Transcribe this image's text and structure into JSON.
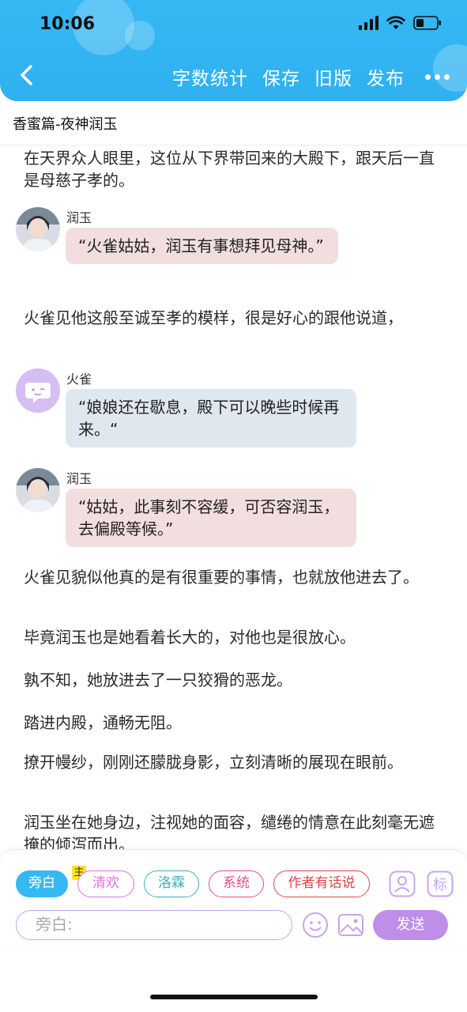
{
  "status_bar": {
    "time": "10:06"
  },
  "header": {
    "actions": [
      "字数统计",
      "保存",
      "旧版",
      "发布"
    ]
  },
  "title": "香蜜篇-夜神润玉",
  "content": {
    "para_1": "在天界众人眼里，这位从下界带回来的大殿下，跟天后一直是母慈子孝的。",
    "chat_1": {
      "speaker": "润玉",
      "text": "“火雀姑姑，润玉有事想拜见母神。”"
    },
    "para_2": "火雀见他这般至诚至孝的模样，很是好心的跟他说道，",
    "chat_2": {
      "speaker": "火雀",
      "text": "“娘娘还在歇息，殿下可以晚些时候再来。“"
    },
    "chat_3": {
      "speaker": "润玉",
      "text": "“姑姑，此事刻不容缓，可否容润玉，去偏殿等候。”"
    },
    "para_3": "火雀见貌似他真的是有很重要的事情，也就放他进去了。",
    "para_4": "毕竟润玉也是她看着长大的，对他也是很放心。",
    "para_5": "孰不知，她放进去了一只狡猾的恶龙。",
    "para_6": "踏进内殿，通畅无阻。",
    "para_7": "撩开幔纱，刚刚还朦胧身影，立刻清晰的展现在眼前。",
    "para_8": "润玉坐在她身边，注视她的面容，缱绻的情意在此刻毫无遮掩的倾泻而出。"
  },
  "toolbar": {
    "roles": [
      {
        "label": "旁白",
        "color": "#35b8f3"
      },
      {
        "label": "清欢",
        "color": "#e070e0"
      },
      {
        "label": "洛霖",
        "color": "#3fb0b0"
      },
      {
        "label": "系统",
        "color": "#e0508a"
      },
      {
        "label": "作者有话说",
        "color": "#e04545"
      }
    ],
    "main_tag": "主",
    "mark_icon_label": "标",
    "input_placeholder": "旁白:",
    "send_label": "发送"
  },
  "colors": {
    "header": "#35b8f3",
    "bubble_pink": "#f2dede",
    "bubble_blue": "#dfe7ef",
    "send": "#bf8ee9"
  }
}
